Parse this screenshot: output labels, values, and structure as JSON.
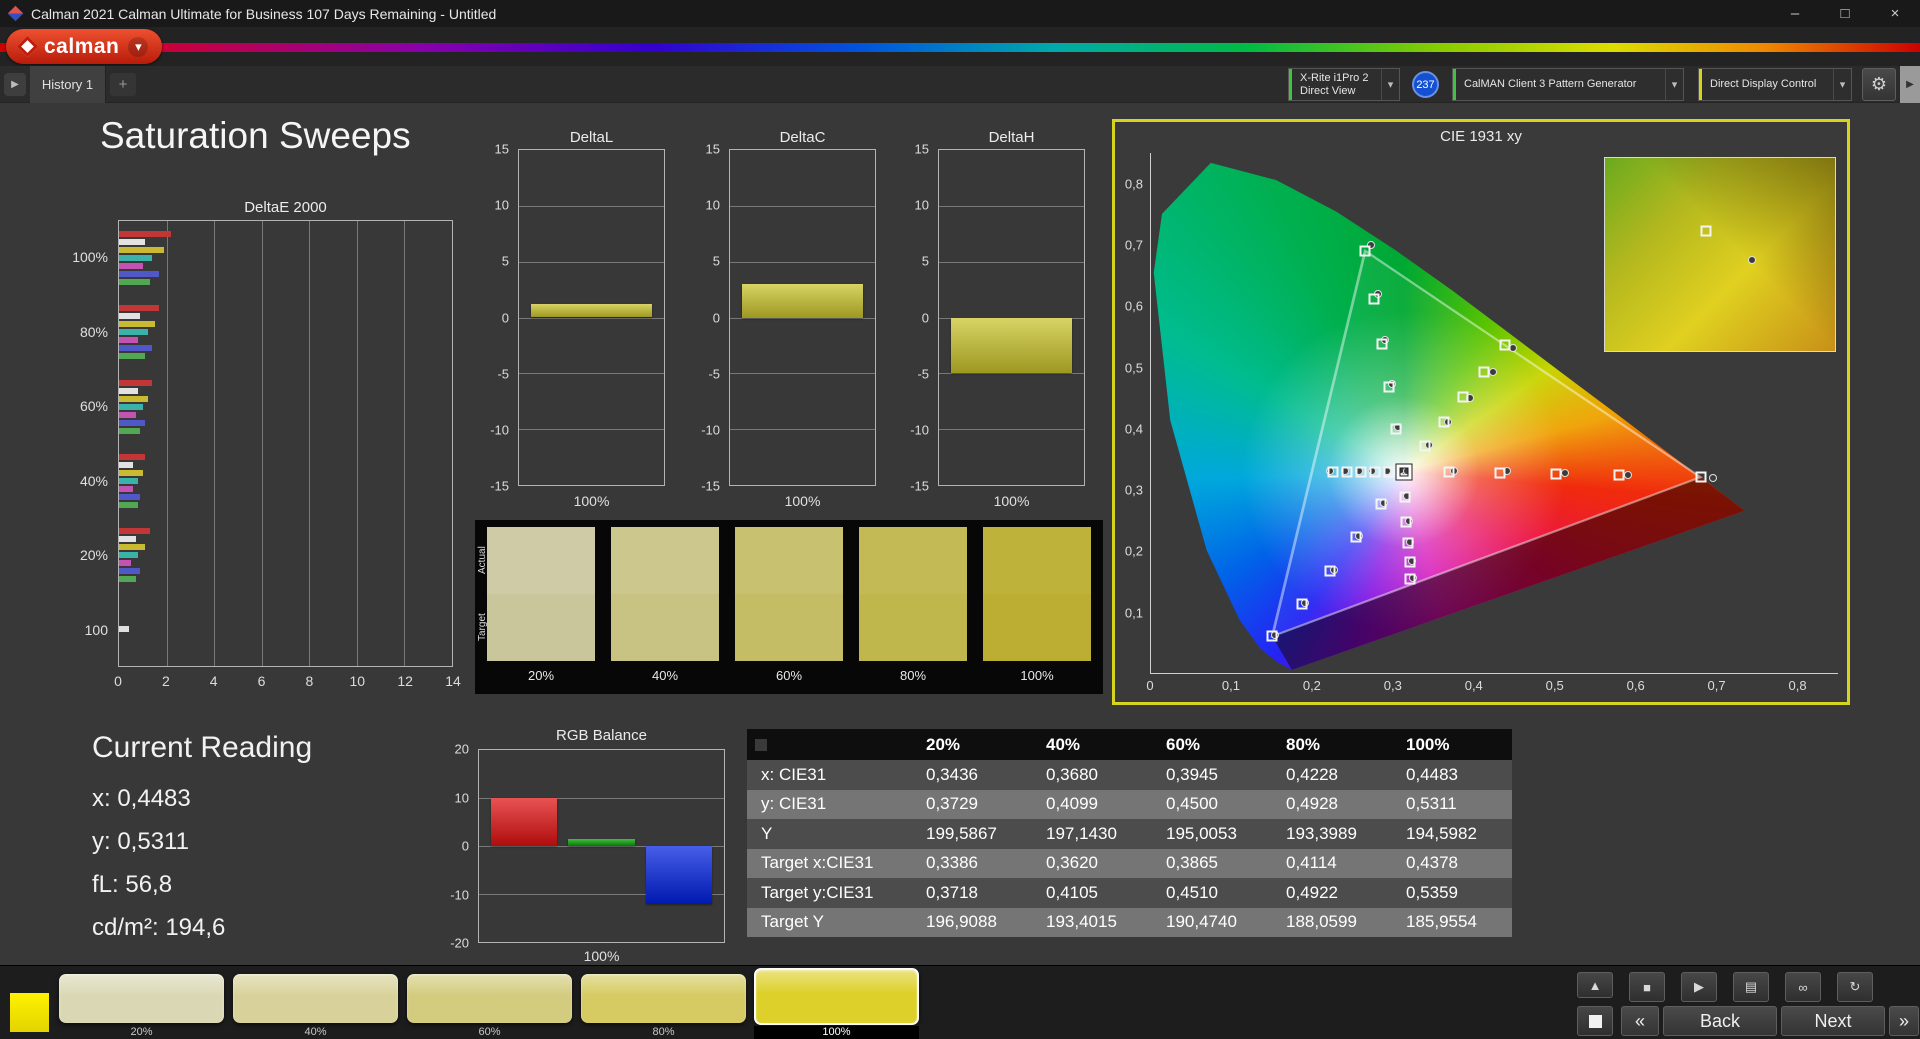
{
  "window": {
    "title": "Calman 2021 Calman Ultimate for Business 107 Days Remaining - Untitled"
  },
  "icons": {
    "minimize": "–",
    "maximize": "□",
    "close": "×",
    "dropdown_arrow": "▾",
    "gear": "⚙",
    "tab_scroll": "▶",
    "add_tab": "+",
    "eject": "▲",
    "stop": "■",
    "play": "▶",
    "save": "▤",
    "link": "∞",
    "refresh": "↻",
    "back_arrow": "«",
    "forward_arrow": "»"
  },
  "logo": {
    "text": "calman"
  },
  "tab_bar": {
    "tabs": [
      {
        "label": "History 1"
      }
    ]
  },
  "toolbar": {
    "meter": {
      "line1": "X-Rite i1Pro 2",
      "line2": "Direct View",
      "accent": "#3ec43e"
    },
    "badge": "237",
    "pattern_generator": {
      "label": "CalMAN Client 3 Pattern Generator",
      "accent": "#3ec43e"
    },
    "display_control": {
      "label": "Direct Display Control",
      "accent": "#d8d41e"
    }
  },
  "page": {
    "title": "Saturation Sweeps"
  },
  "current_reading": {
    "title": "Current Reading",
    "lines": [
      "x: 0,4483",
      "y: 0,5311",
      "fL: 56,8",
      "cd/m²: 194,6"
    ]
  },
  "swatch_strip": {
    "row_labels": [
      "Actual",
      "Target"
    ],
    "columns": [
      {
        "label": "20%",
        "actual": "#cecba6",
        "target": "#c9c69c"
      },
      {
        "label": "40%",
        "actual": "#ccc78d",
        "target": "#c8c383"
      },
      {
        "label": "60%",
        "actual": "#c8c170",
        "target": "#c4bd66"
      },
      {
        "label": "80%",
        "actual": "#c3ba55",
        "target": "#bfb64c"
      },
      {
        "label": "100%",
        "actual": "#bfb23a",
        "target": "#bbae33"
      }
    ]
  },
  "table": {
    "columns": [
      "20%",
      "40%",
      "60%",
      "80%",
      "100%"
    ],
    "rows": [
      {
        "label": "x: CIE31",
        "values": [
          "0,3436",
          "0,3680",
          "0,3945",
          "0,4228",
          "0,4483"
        ]
      },
      {
        "label": "y: CIE31",
        "values": [
          "0,3729",
          "0,4099",
          "0,4500",
          "0,4928",
          "0,5311"
        ]
      },
      {
        "label": "Y",
        "values": [
          "199,5867",
          "197,1430",
          "195,0053",
          "193,3989",
          "194,5982"
        ]
      },
      {
        "label": "Target x:CIE31",
        "values": [
          "0,3386",
          "0,3620",
          "0,3865",
          "0,4114",
          "0,4378"
        ]
      },
      {
        "label": "Target y:CIE31",
        "values": [
          "0,3718",
          "0,4105",
          "0,4510",
          "0,4922",
          "0,5359"
        ]
      },
      {
        "label": "Target Y",
        "values": [
          "196,9088",
          "193,4015",
          "190,4740",
          "188,0599",
          "185,9554"
        ]
      }
    ]
  },
  "bottom_bar": {
    "swatches": [
      {
        "label": "20%",
        "color": "#dad8b4",
        "active": false
      },
      {
        "label": "40%",
        "color": "#d8d29a",
        "active": false
      },
      {
        "label": "60%",
        "color": "#d3cb7d",
        "active": false
      },
      {
        "label": "80%",
        "color": "#d5cb62",
        "active": false
      },
      {
        "label": "100%",
        "color": "#ddd02a",
        "active": true
      }
    ],
    "back_label": "Back",
    "next_label": "Next"
  },
  "chart_data": [
    {
      "id": "deltaE",
      "type": "bar",
      "orientation": "horizontal",
      "title": "DeltaE 2000",
      "xlim": [
        0,
        14
      ],
      "xticks": [
        0,
        2,
        4,
        6,
        8,
        10,
        12,
        14
      ],
      "bar_colors": [
        "#c23636",
        "#e2e2e2",
        "#c9ba32",
        "#3ab2aa",
        "#c253b2",
        "#5058c8",
        "#52a852"
      ],
      "groups": [
        {
          "label": "100%",
          "values": [
            2.2,
            1.1,
            1.9,
            1.4,
            1.0,
            1.7,
            1.3
          ]
        },
        {
          "label": "80%",
          "values": [
            1.7,
            0.9,
            1.5,
            1.2,
            0.8,
            1.4,
            1.1
          ]
        },
        {
          "label": "60%",
          "values": [
            1.4,
            0.8,
            1.2,
            1.0,
            0.7,
            1.1,
            0.9
          ]
        },
        {
          "label": "40%",
          "values": [
            1.1,
            0.6,
            1.0,
            0.8,
            0.6,
            0.9,
            0.8
          ]
        },
        {
          "label": "20%",
          "values": [
            1.3,
            0.7,
            1.1,
            0.8,
            0.5,
            0.9,
            0.7
          ]
        },
        {
          "label": "100",
          "values": [
            0.4
          ],
          "colors": [
            "#e0e0e0"
          ]
        }
      ]
    },
    {
      "id": "deltaL",
      "type": "bar",
      "title": "DeltaL",
      "ylim": [
        -15,
        15
      ],
      "yticks": [
        15,
        10,
        5,
        0,
        -5,
        -10,
        -15
      ],
      "xlabel": "100%",
      "bars": [
        {
          "name": "DeltaL",
          "color": "#c9c32a",
          "value": 1.2
        }
      ]
    },
    {
      "id": "deltaC",
      "type": "bar",
      "title": "DeltaC",
      "ylim": [
        -15,
        15
      ],
      "yticks": [
        15,
        10,
        5,
        0,
        -5,
        -10,
        -15
      ],
      "xlabel": "100%",
      "bars": [
        {
          "name": "DeltaC",
          "color": "#c9c32a",
          "value": 3.0
        }
      ]
    },
    {
      "id": "deltaH",
      "type": "bar",
      "title": "DeltaH",
      "ylim": [
        -15,
        15
      ],
      "yticks": [
        15,
        10,
        5,
        0,
        -5,
        -10,
        -15
      ],
      "xlabel": "100%",
      "bars": [
        {
          "name": "DeltaH",
          "color": "#c9c32a",
          "value": -5.0
        }
      ]
    },
    {
      "id": "rgb_balance",
      "type": "bar",
      "title": "RGB Balance",
      "ylim": [
        -20,
        20
      ],
      "yticks": [
        20,
        10,
        0,
        -10,
        -20
      ],
      "xlabel": "100%",
      "bars": [
        {
          "name": "Red",
          "color": "#e01010",
          "value": 10
        },
        {
          "name": "Green",
          "color": "#00a000",
          "value": 1.5
        },
        {
          "name": "Blue",
          "color": "#0020e0",
          "value": -12
        }
      ]
    },
    {
      "id": "cie",
      "type": "scatter",
      "title": "CIE 1931 xy",
      "xlim": [
        0,
        0.85
      ],
      "ylim": [
        0,
        0.85
      ],
      "tick_step": 0.1,
      "xtick_labels": [
        "0",
        "0,1",
        "0,2",
        "0,3",
        "0,4",
        "0,5",
        "0,6",
        "0,7",
        "0,8"
      ],
      "ytick_labels": [
        "0,8",
        "0,7",
        "0,6",
        "0,5",
        "0,4",
        "0,3",
        "0,2",
        "0,1"
      ],
      "gamut_triangle": [
        [
          0.68,
          0.32
        ],
        [
          0.265,
          0.69
        ],
        [
          0.15,
          0.06
        ]
      ],
      "white_point": [
        0.3127,
        0.329
      ],
      "highlight_point": [
        0.3127,
        0.329
      ],
      "target_points": [
        [
          0.3386,
          0.3718
        ],
        [
          0.362,
          0.4105
        ],
        [
          0.3865,
          0.451
        ],
        [
          0.4114,
          0.4922
        ],
        [
          0.4378,
          0.5359
        ],
        [
          0.369,
          0.328
        ],
        [
          0.432,
          0.327
        ],
        [
          0.501,
          0.325
        ],
        [
          0.579,
          0.323
        ],
        [
          0.68,
          0.32
        ],
        [
          0.303,
          0.399
        ],
        [
          0.295,
          0.468
        ],
        [
          0.286,
          0.538
        ],
        [
          0.276,
          0.612
        ],
        [
          0.265,
          0.69
        ],
        [
          0.285,
          0.276
        ],
        [
          0.254,
          0.222
        ],
        [
          0.222,
          0.167
        ],
        [
          0.187,
          0.112
        ],
        [
          0.15,
          0.06
        ],
        [
          0.314,
          0.287
        ],
        [
          0.316,
          0.247
        ],
        [
          0.318,
          0.212
        ],
        [
          0.32,
          0.181
        ],
        [
          0.321,
          0.154
        ],
        [
          0.295,
          0.329
        ],
        [
          0.277,
          0.329
        ],
        [
          0.26,
          0.329
        ],
        [
          0.243,
          0.329
        ],
        [
          0.225,
          0.329
        ]
      ],
      "measured_points": [
        [
          0.3436,
          0.3729
        ],
        [
          0.368,
          0.4099
        ],
        [
          0.3945,
          0.45
        ],
        [
          0.4228,
          0.4928
        ],
        [
          0.4483,
          0.5311
        ],
        [
          0.375,
          0.331
        ],
        [
          0.44,
          0.33
        ],
        [
          0.512,
          0.327
        ],
        [
          0.59,
          0.324
        ],
        [
          0.695,
          0.318
        ],
        [
          0.306,
          0.402
        ],
        [
          0.298,
          0.472
        ],
        [
          0.29,
          0.545
        ],
        [
          0.281,
          0.62
        ],
        [
          0.272,
          0.7
        ],
        [
          0.288,
          0.278
        ],
        [
          0.257,
          0.224
        ],
        [
          0.226,
          0.169
        ],
        [
          0.191,
          0.114
        ],
        [
          0.154,
          0.062
        ],
        [
          0.317,
          0.289
        ],
        [
          0.319,
          0.249
        ],
        [
          0.321,
          0.214
        ],
        [
          0.323,
          0.183
        ],
        [
          0.324,
          0.156
        ],
        [
          0.292,
          0.33
        ],
        [
          0.274,
          0.33
        ],
        [
          0.257,
          0.33
        ],
        [
          0.24,
          0.33
        ],
        [
          0.222,
          0.33
        ],
        [
          0.313,
          0.33
        ],
        [
          0.309,
          0.332
        ],
        [
          0.317,
          0.331
        ]
      ],
      "inset_markers": [
        {
          "shape": "square",
          "x_pct": 44,
          "y_pct": 38
        },
        {
          "shape": "circle",
          "x_pct": 64,
          "y_pct": 53
        }
      ]
    }
  ]
}
